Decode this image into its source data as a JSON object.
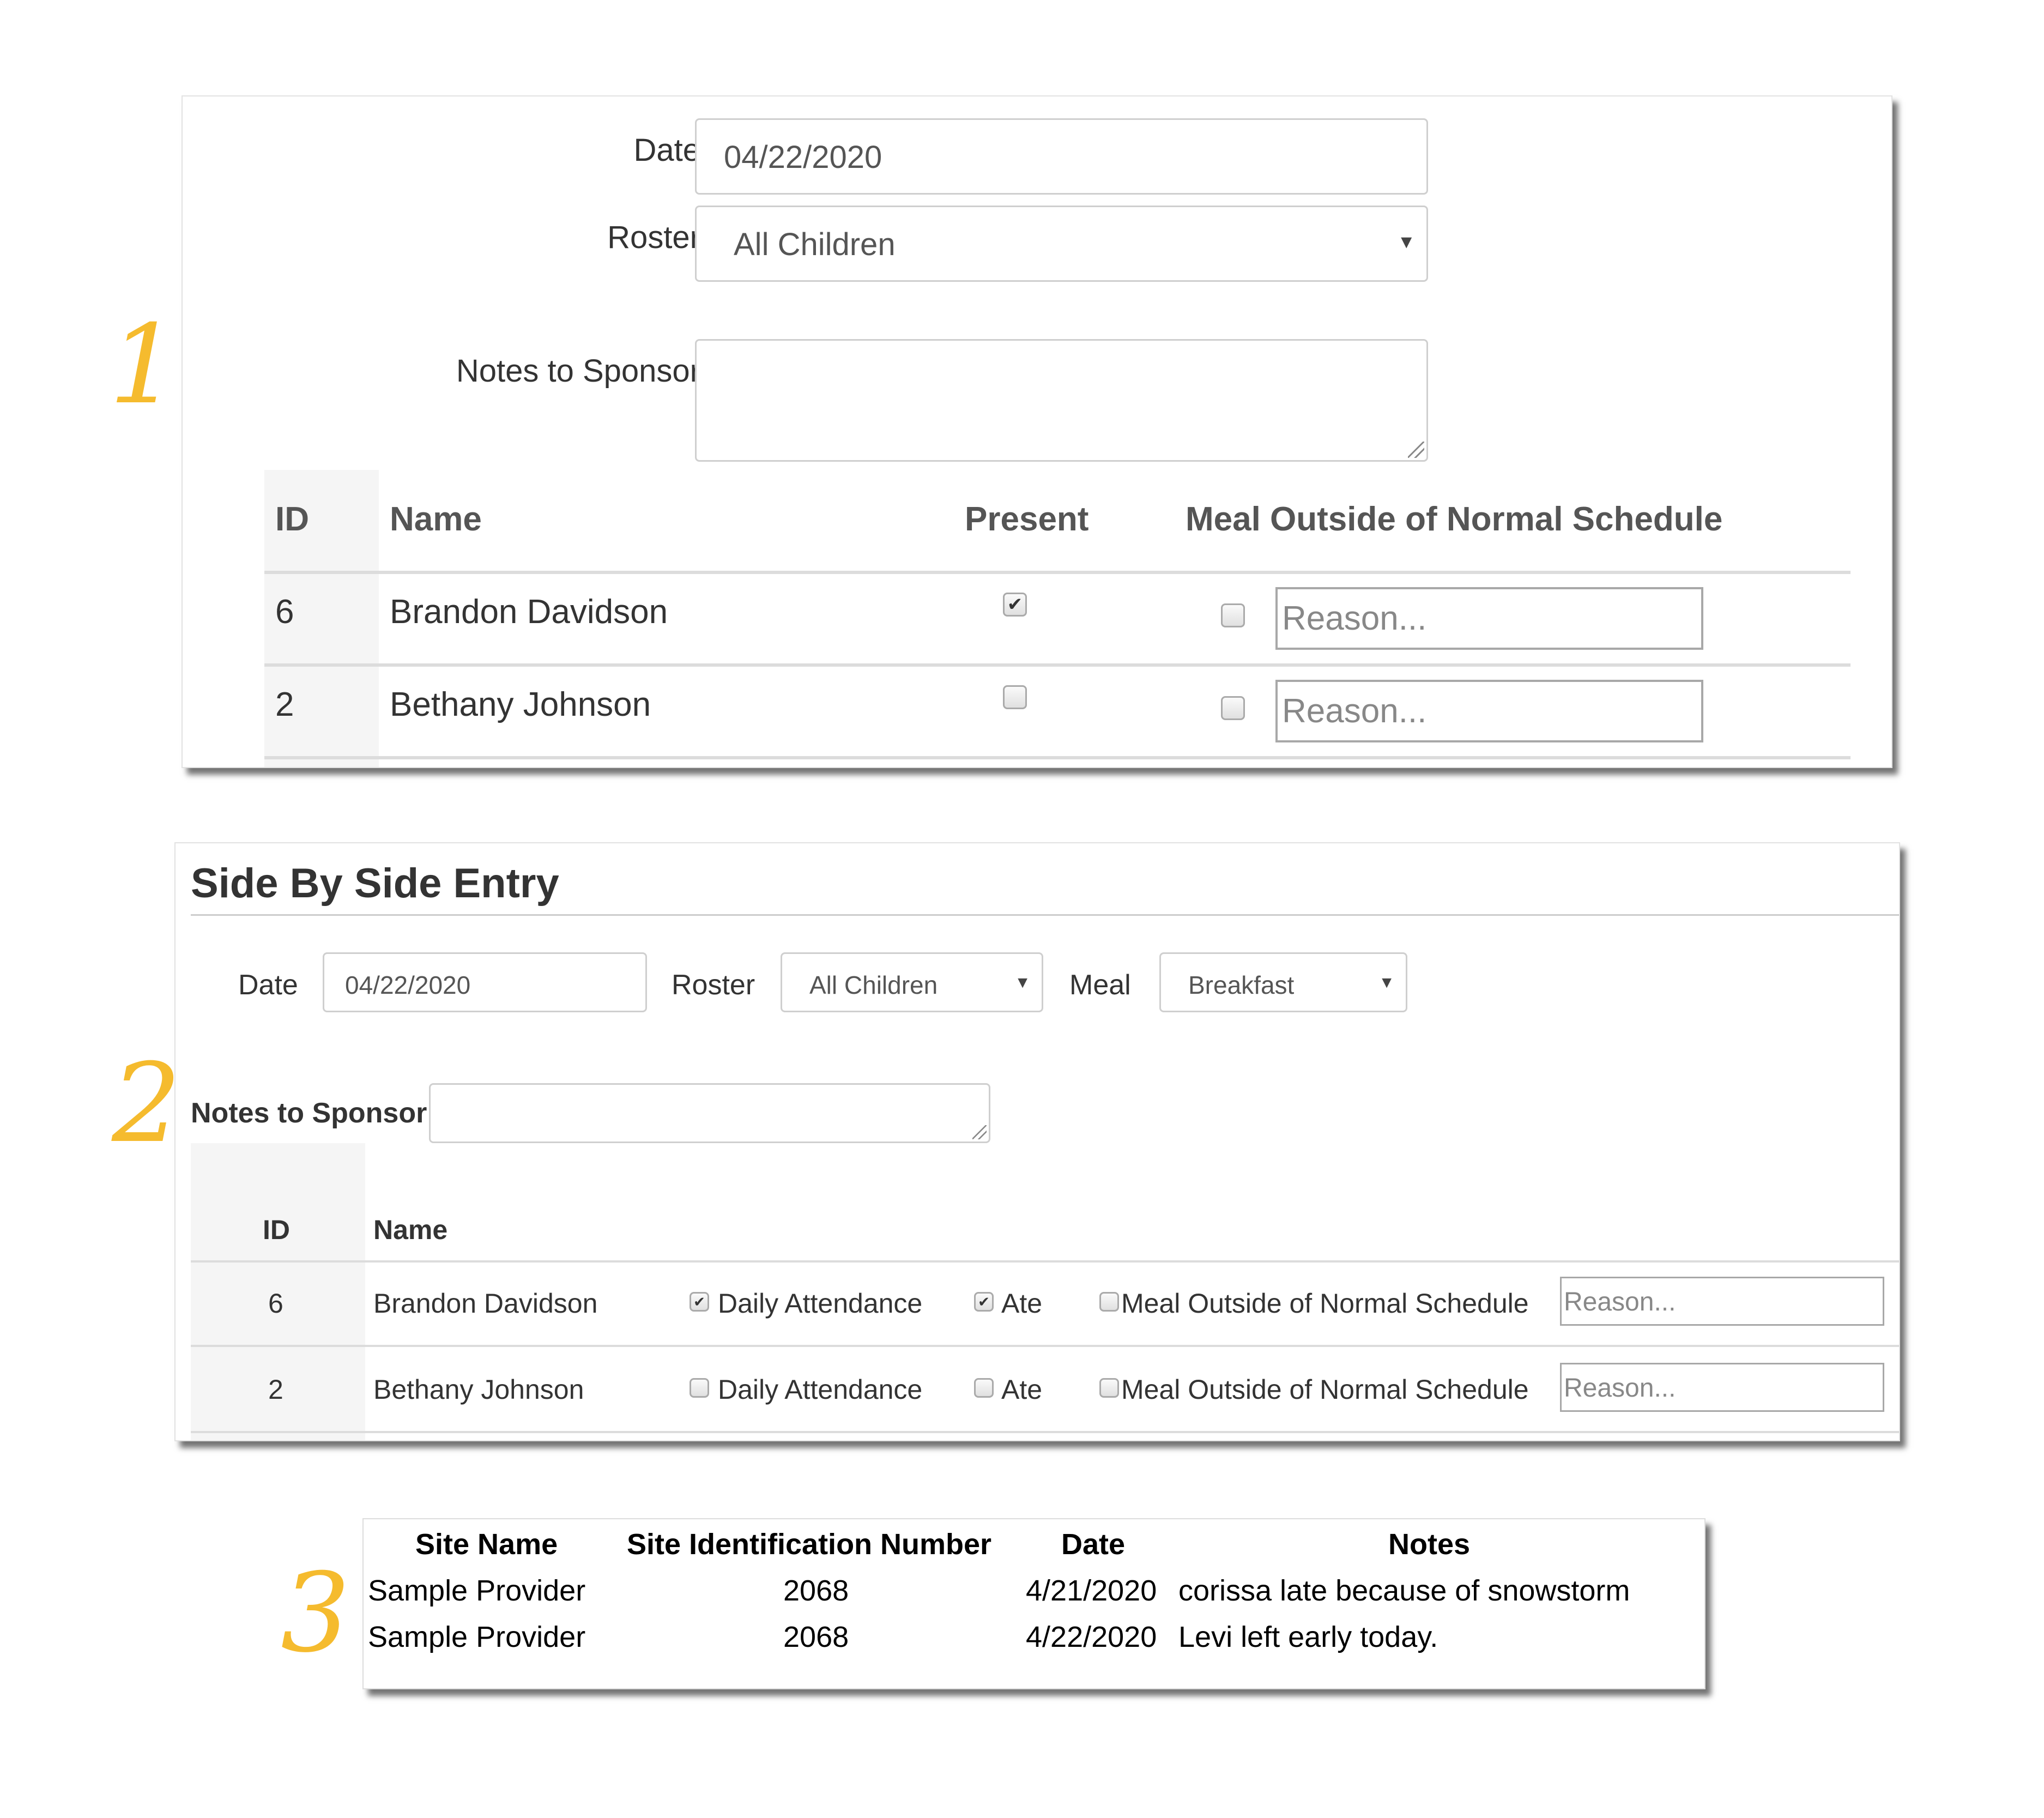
{
  "colors": {
    "step_accent": "#F5BB2E"
  },
  "steps": [
    "1",
    "2",
    "3"
  ],
  "panel1": {
    "date_label": "Date",
    "date_value": "04/22/2020",
    "roster_label": "Roster",
    "roster_value": "All Children",
    "notes_label": "Notes to Sponsor",
    "notes_value": "",
    "columns": [
      "ID",
      "Name",
      "Present",
      "Meal Outside of Normal Schedule"
    ],
    "rows": [
      {
        "id": "6",
        "name": "Brandon Davidson",
        "present": true,
        "meal_outside": false,
        "reason_placeholder": "Reason..."
      },
      {
        "id": "2",
        "name": "Bethany Johnson",
        "present": false,
        "meal_outside": false,
        "reason_placeholder": "Reason..."
      }
    ]
  },
  "panel2": {
    "title": "Side By Side Entry",
    "date_label": "Date",
    "date_value": "04/22/2020",
    "roster_label": "Roster",
    "roster_value": "All Children",
    "meal_label": "Meal",
    "meal_value": "Breakfast",
    "notes_label": "Notes to Sponsor",
    "notes_value": "",
    "columns": [
      "ID",
      "Name"
    ],
    "daily_attendance_label": "Daily Attendance",
    "ate_label": "Ate",
    "meal_outside_label": "Meal Outside of Normal Schedule",
    "rows": [
      {
        "id": "6",
        "name": "Brandon Davidson",
        "daily_attendance": true,
        "ate": true,
        "meal_outside": false,
        "reason_placeholder": "Reason..."
      },
      {
        "id": "2",
        "name": "Bethany Johnson",
        "daily_attendance": false,
        "ate": false,
        "meal_outside": false,
        "reason_placeholder": "Reason..."
      }
    ]
  },
  "panel3": {
    "columns": [
      "Site Name",
      "Site Identification Number",
      "Date",
      "Notes"
    ],
    "rows": [
      {
        "site_name": "Sample Provider",
        "site_id": "2068",
        "date": "4/21/2020",
        "notes": "corissa late because of snowstorm"
      },
      {
        "site_name": "Sample Provider",
        "site_id": "2068",
        "date": "4/22/2020",
        "notes": "Levi left early today."
      }
    ]
  }
}
